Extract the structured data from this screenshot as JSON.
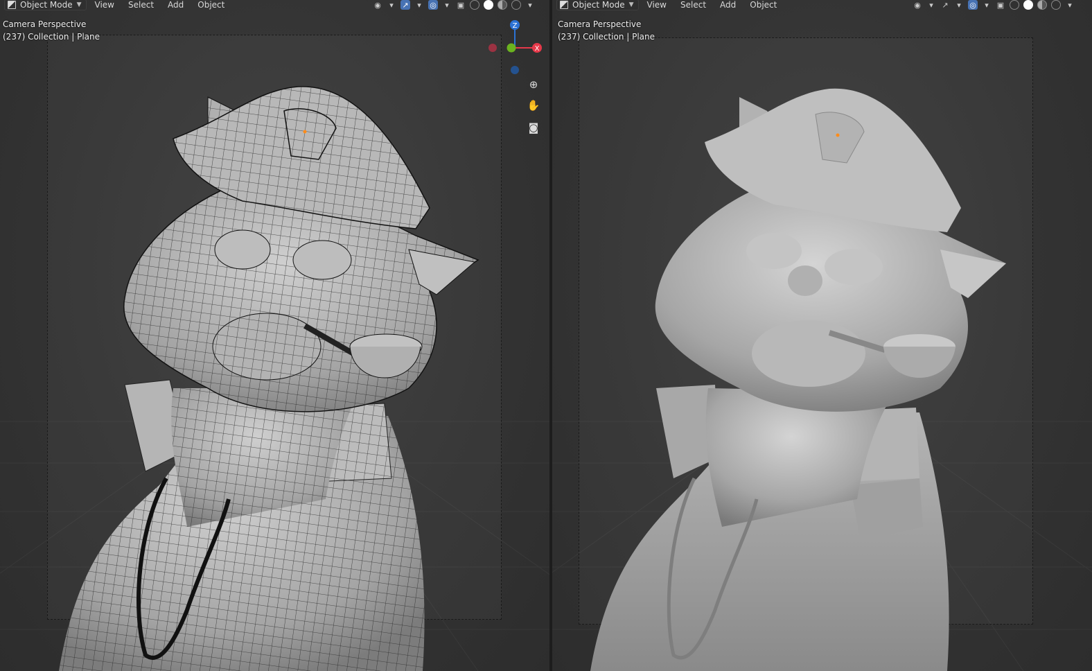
{
  "left_viewport": {
    "mode": "Object Mode",
    "menus": [
      "View",
      "Select",
      "Add",
      "Object"
    ],
    "overlay_title": "Camera Perspective",
    "overlay_info": "(237) Collection | Plane",
    "shading": "wireframe overlay on solid",
    "gizmo": {
      "z_label": "Z",
      "x_label": "X"
    }
  },
  "right_viewport": {
    "mode": "Object Mode",
    "menus": [
      "View",
      "Select",
      "Add",
      "Object"
    ],
    "overlay_title": "Camera Perspective",
    "overlay_info": "(237) Collection | Plane",
    "shading": "solid"
  },
  "icons": {
    "mode_icon": "object-mode-icon",
    "gizmo_zoom": "zoom-icon",
    "gizmo_pan": "hand-icon",
    "gizmo_camera": "camera-icon",
    "visibility": "eye-icon",
    "overlay": "overlay-icon",
    "xray": "xray-icon"
  },
  "colors": {
    "background": "#2b2b2b",
    "active_header_button": "#4772b3",
    "axis_x": "#e6394a",
    "axis_y": "#6bb31f",
    "axis_z": "#2c72d4",
    "model_gray": "#9a9a9a"
  }
}
